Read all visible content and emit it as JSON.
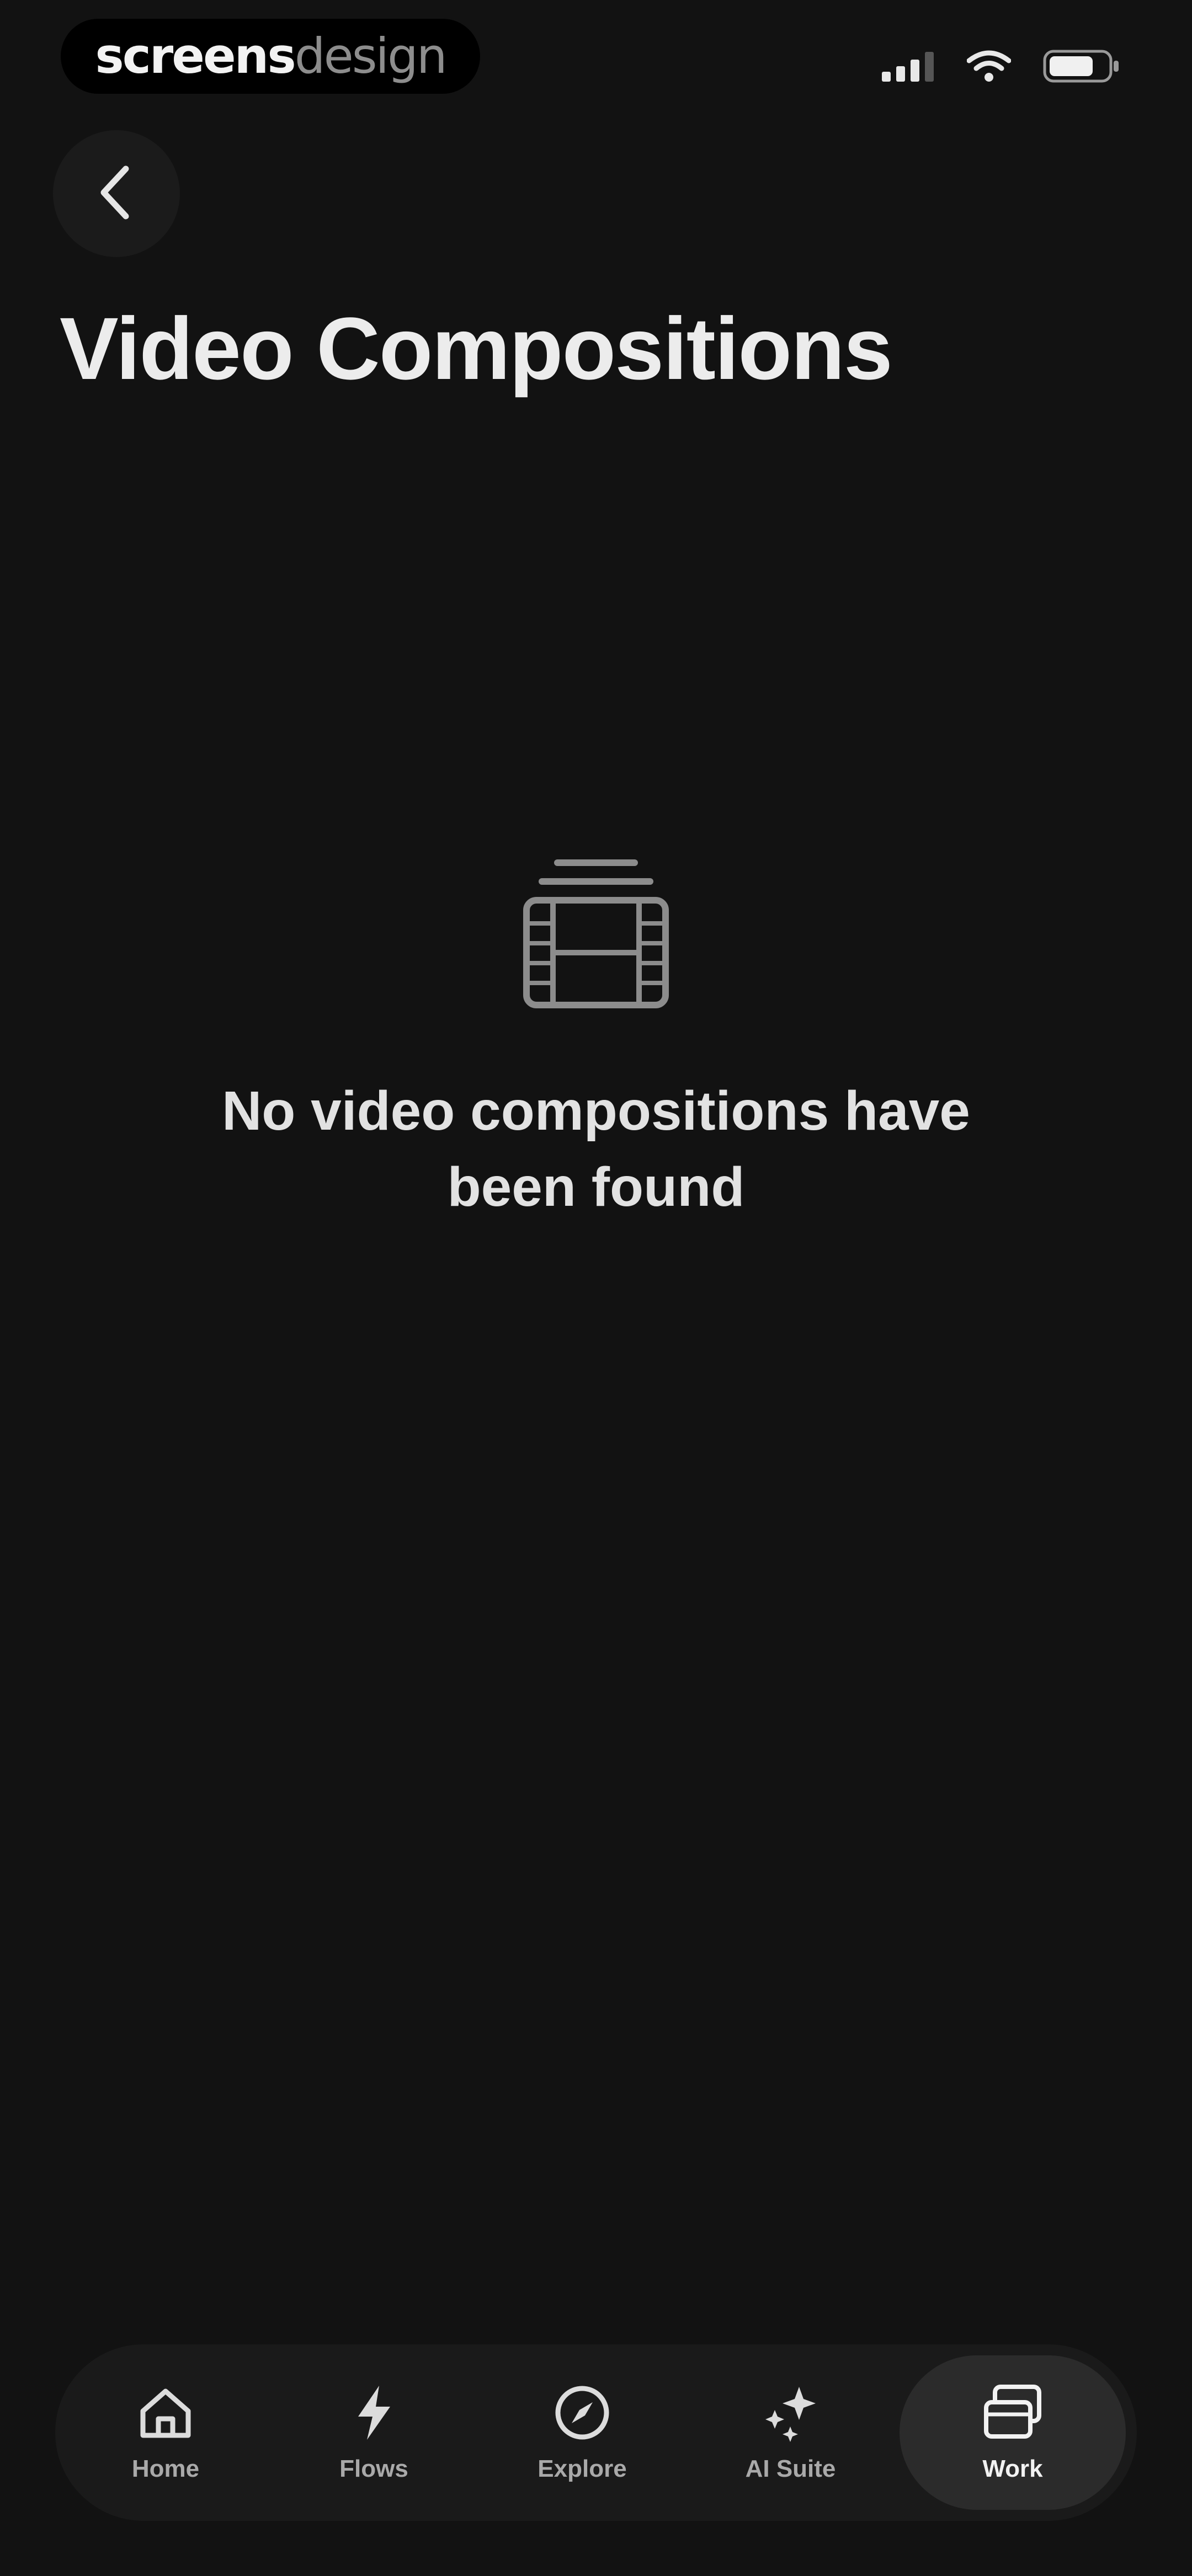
{
  "status_bar": {
    "brand_strong": "screens",
    "brand_light": "design",
    "signal_icon": "cellular-signal-icon",
    "wifi_icon": "wifi-icon",
    "battery_icon": "battery-icon"
  },
  "header": {
    "back_icon": "chevron-left-icon",
    "title": "Video Compositions"
  },
  "empty_state": {
    "icon": "film-stack-icon",
    "message": "No video compositions have been found"
  },
  "bottom_nav": {
    "active": "work",
    "items": [
      {
        "id": "home",
        "label": "Home",
        "icon": "home-icon"
      },
      {
        "id": "flows",
        "label": "Flows",
        "icon": "lightning-icon"
      },
      {
        "id": "explore",
        "label": "Explore",
        "icon": "compass-icon"
      },
      {
        "id": "ai_suite",
        "label": "AI Suite",
        "icon": "sparkles-icon"
      },
      {
        "id": "work",
        "label": "Work",
        "icon": "work-stack-icon"
      }
    ]
  },
  "colors": {
    "background": "#121212",
    "nav_background": "#1a1a1a",
    "active_pill": "#2b2b2b",
    "text_primary": "#ececec",
    "text_secondary": "#a9a9a9"
  }
}
